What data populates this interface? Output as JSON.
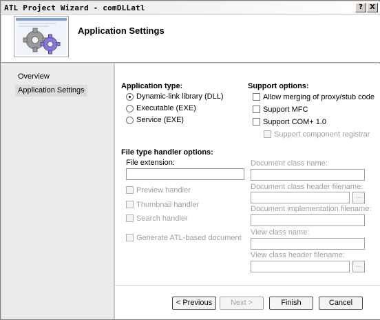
{
  "window": {
    "title": "ATL Project Wizard - comDLLatl",
    "help_btn": "?",
    "close_btn": "X"
  },
  "header": {
    "title": "Application Settings"
  },
  "nav": {
    "items": [
      {
        "label": "Overview"
      },
      {
        "label": "Application Settings"
      }
    ]
  },
  "app_type": {
    "heading": "Application type:",
    "options": [
      {
        "label": "Dynamic-link library (DLL)",
        "selected": true
      },
      {
        "label": "Executable (EXE)",
        "selected": false
      },
      {
        "label": "Service (EXE)",
        "selected": false
      }
    ]
  },
  "support": {
    "heading": "Support options:",
    "options": [
      {
        "label": "Allow merging of proxy/stub code",
        "enabled": true
      },
      {
        "label": "Support MFC",
        "enabled": true
      },
      {
        "label": "Support COM+ 1.0",
        "enabled": true
      },
      {
        "label": "Support component registrar",
        "enabled": false
      }
    ]
  },
  "file_type": {
    "heading": "File type handler options:",
    "file_extension_label": "File extension:",
    "file_extension_value": "",
    "handlers": [
      {
        "label": "Preview handler"
      },
      {
        "label": "Thumbnail handler"
      },
      {
        "label": "Search handler"
      },
      {
        "label": "Generate ATL-based document"
      }
    ],
    "doc_class_name_label": "Document class name:",
    "doc_class_header_label": "Document class header filename:",
    "doc_impl_label": "Document implementation filename:",
    "view_class_name_label": "View class name:",
    "view_class_header_label": "View class header filename:",
    "ellipsis": "..."
  },
  "buttons": {
    "previous": "< Previous",
    "next": "Next >",
    "finish": "Finish",
    "cancel": "Cancel"
  },
  "colors": {
    "window_bg": "#d4d0c8",
    "nav_bg": "#ebebeb",
    "content_bg": "#ffffff",
    "disabled_text": "#a0a0a0"
  }
}
